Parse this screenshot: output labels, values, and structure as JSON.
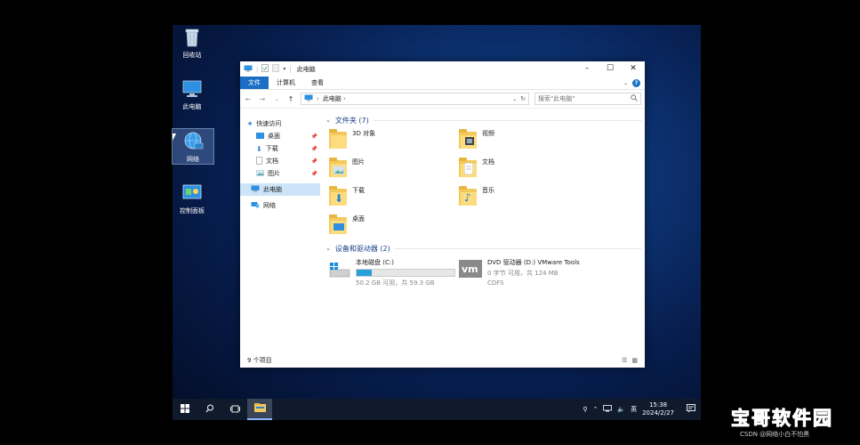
{
  "desktop": {
    "icons": [
      {
        "label": "回收站"
      },
      {
        "label": "此电脑"
      },
      {
        "label": "网络"
      },
      {
        "label": "控制面板"
      }
    ]
  },
  "explorer": {
    "title": "此电脑",
    "ribbon_tabs": [
      "文件",
      "计算机",
      "查看"
    ],
    "address": "此电脑",
    "search_placeholder": "搜索\"此电脑\"",
    "nav": {
      "quick_access": "快速访问",
      "quick_items": [
        "桌面",
        "下载",
        "文档",
        "图片"
      ],
      "this_pc": "此电脑",
      "network": "网络"
    },
    "folders_header": "文件夹 (7)",
    "folders": [
      "3D 对象",
      "视频",
      "图片",
      "文档",
      "下载",
      "音乐",
      "桌面"
    ],
    "devices_header": "设备和驱动器 (2)",
    "drives": [
      {
        "name": "本地磁盘 (C:)",
        "detail": "50.2 GB 可用，共 59.3 GB",
        "used_fraction": 0.153
      },
      {
        "name": "DVD 驱动器 (D:) VMware Tools",
        "detail": "0 字节 可用，共 124 MB",
        "fs": "CDFS"
      }
    ],
    "status": "9 个项目"
  },
  "taskbar": {
    "ime": "英",
    "time": "15:38",
    "date": "2024/2/27"
  },
  "watermark": {
    "main": "宝哥软件园",
    "sub": "CSDN @网络小白不怕黑"
  },
  "colors": {
    "accent": "#1a6fc4",
    "folder": "#f3c95b",
    "drive_fill": "#26a0da"
  }
}
